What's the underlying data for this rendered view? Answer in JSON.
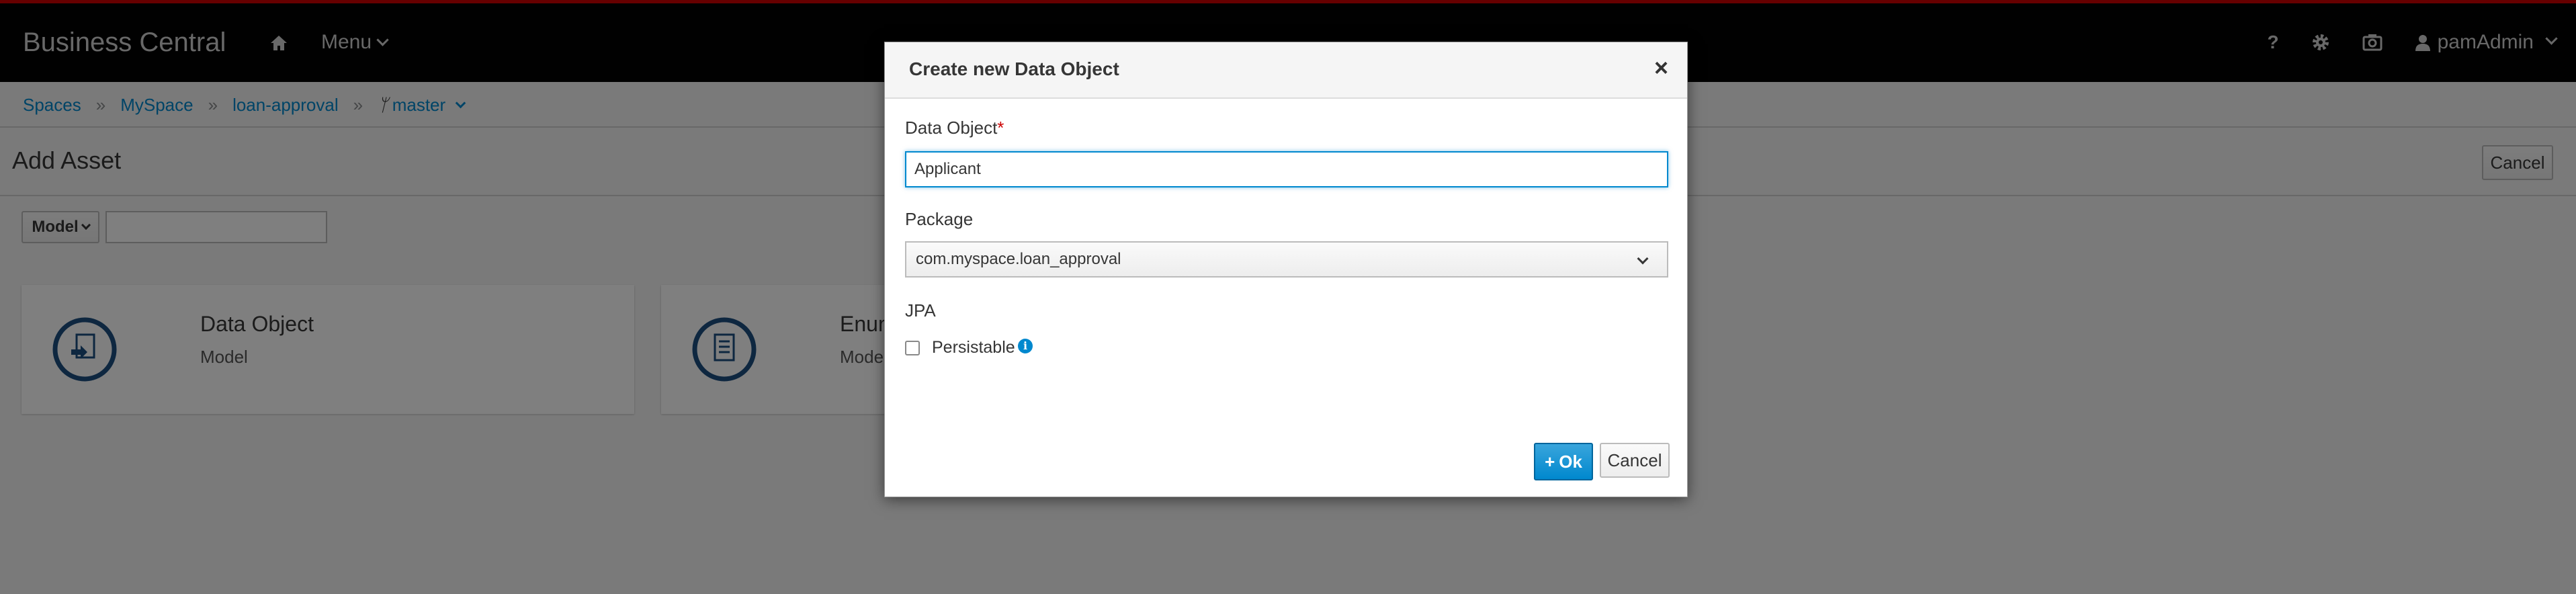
{
  "app": {
    "brand": "Business Central",
    "menu_label": "Menu",
    "user": "pamAdmin"
  },
  "breadcrumb": {
    "items": [
      "Spaces",
      "MySpace",
      "loan-approval"
    ],
    "branch": "master",
    "separator": "»"
  },
  "page": {
    "title": "Add Asset",
    "cancel_label": "Cancel",
    "filter_select": "Model",
    "filter_value": ""
  },
  "cards": [
    {
      "title": "Data Object",
      "subtitle": "Model"
    },
    {
      "title": "Enum",
      "subtitle": "Model"
    }
  ],
  "modal": {
    "title": "Create new Data Object",
    "close_glyph": "×",
    "name_label": "Data Object",
    "required_mark": "*",
    "name_value": "Applicant",
    "package_label": "Package",
    "package_value": "com.myspace.loan_approval",
    "jpa_label": "JPA",
    "persistable_label": "Persistable",
    "persistable_checked": false,
    "ok_label": "Ok",
    "cancel_label": "Cancel"
  },
  "icons": {
    "home": "home-icon",
    "help": "help-icon",
    "settings": "gear-icon",
    "camera": "camera-icon",
    "user": "user-icon",
    "info": "info-icon"
  },
  "colors": {
    "accent": "#0088ce",
    "topbar": "#030303",
    "topbar_border": "#cc0000",
    "card_icon": "#1c4e80"
  }
}
